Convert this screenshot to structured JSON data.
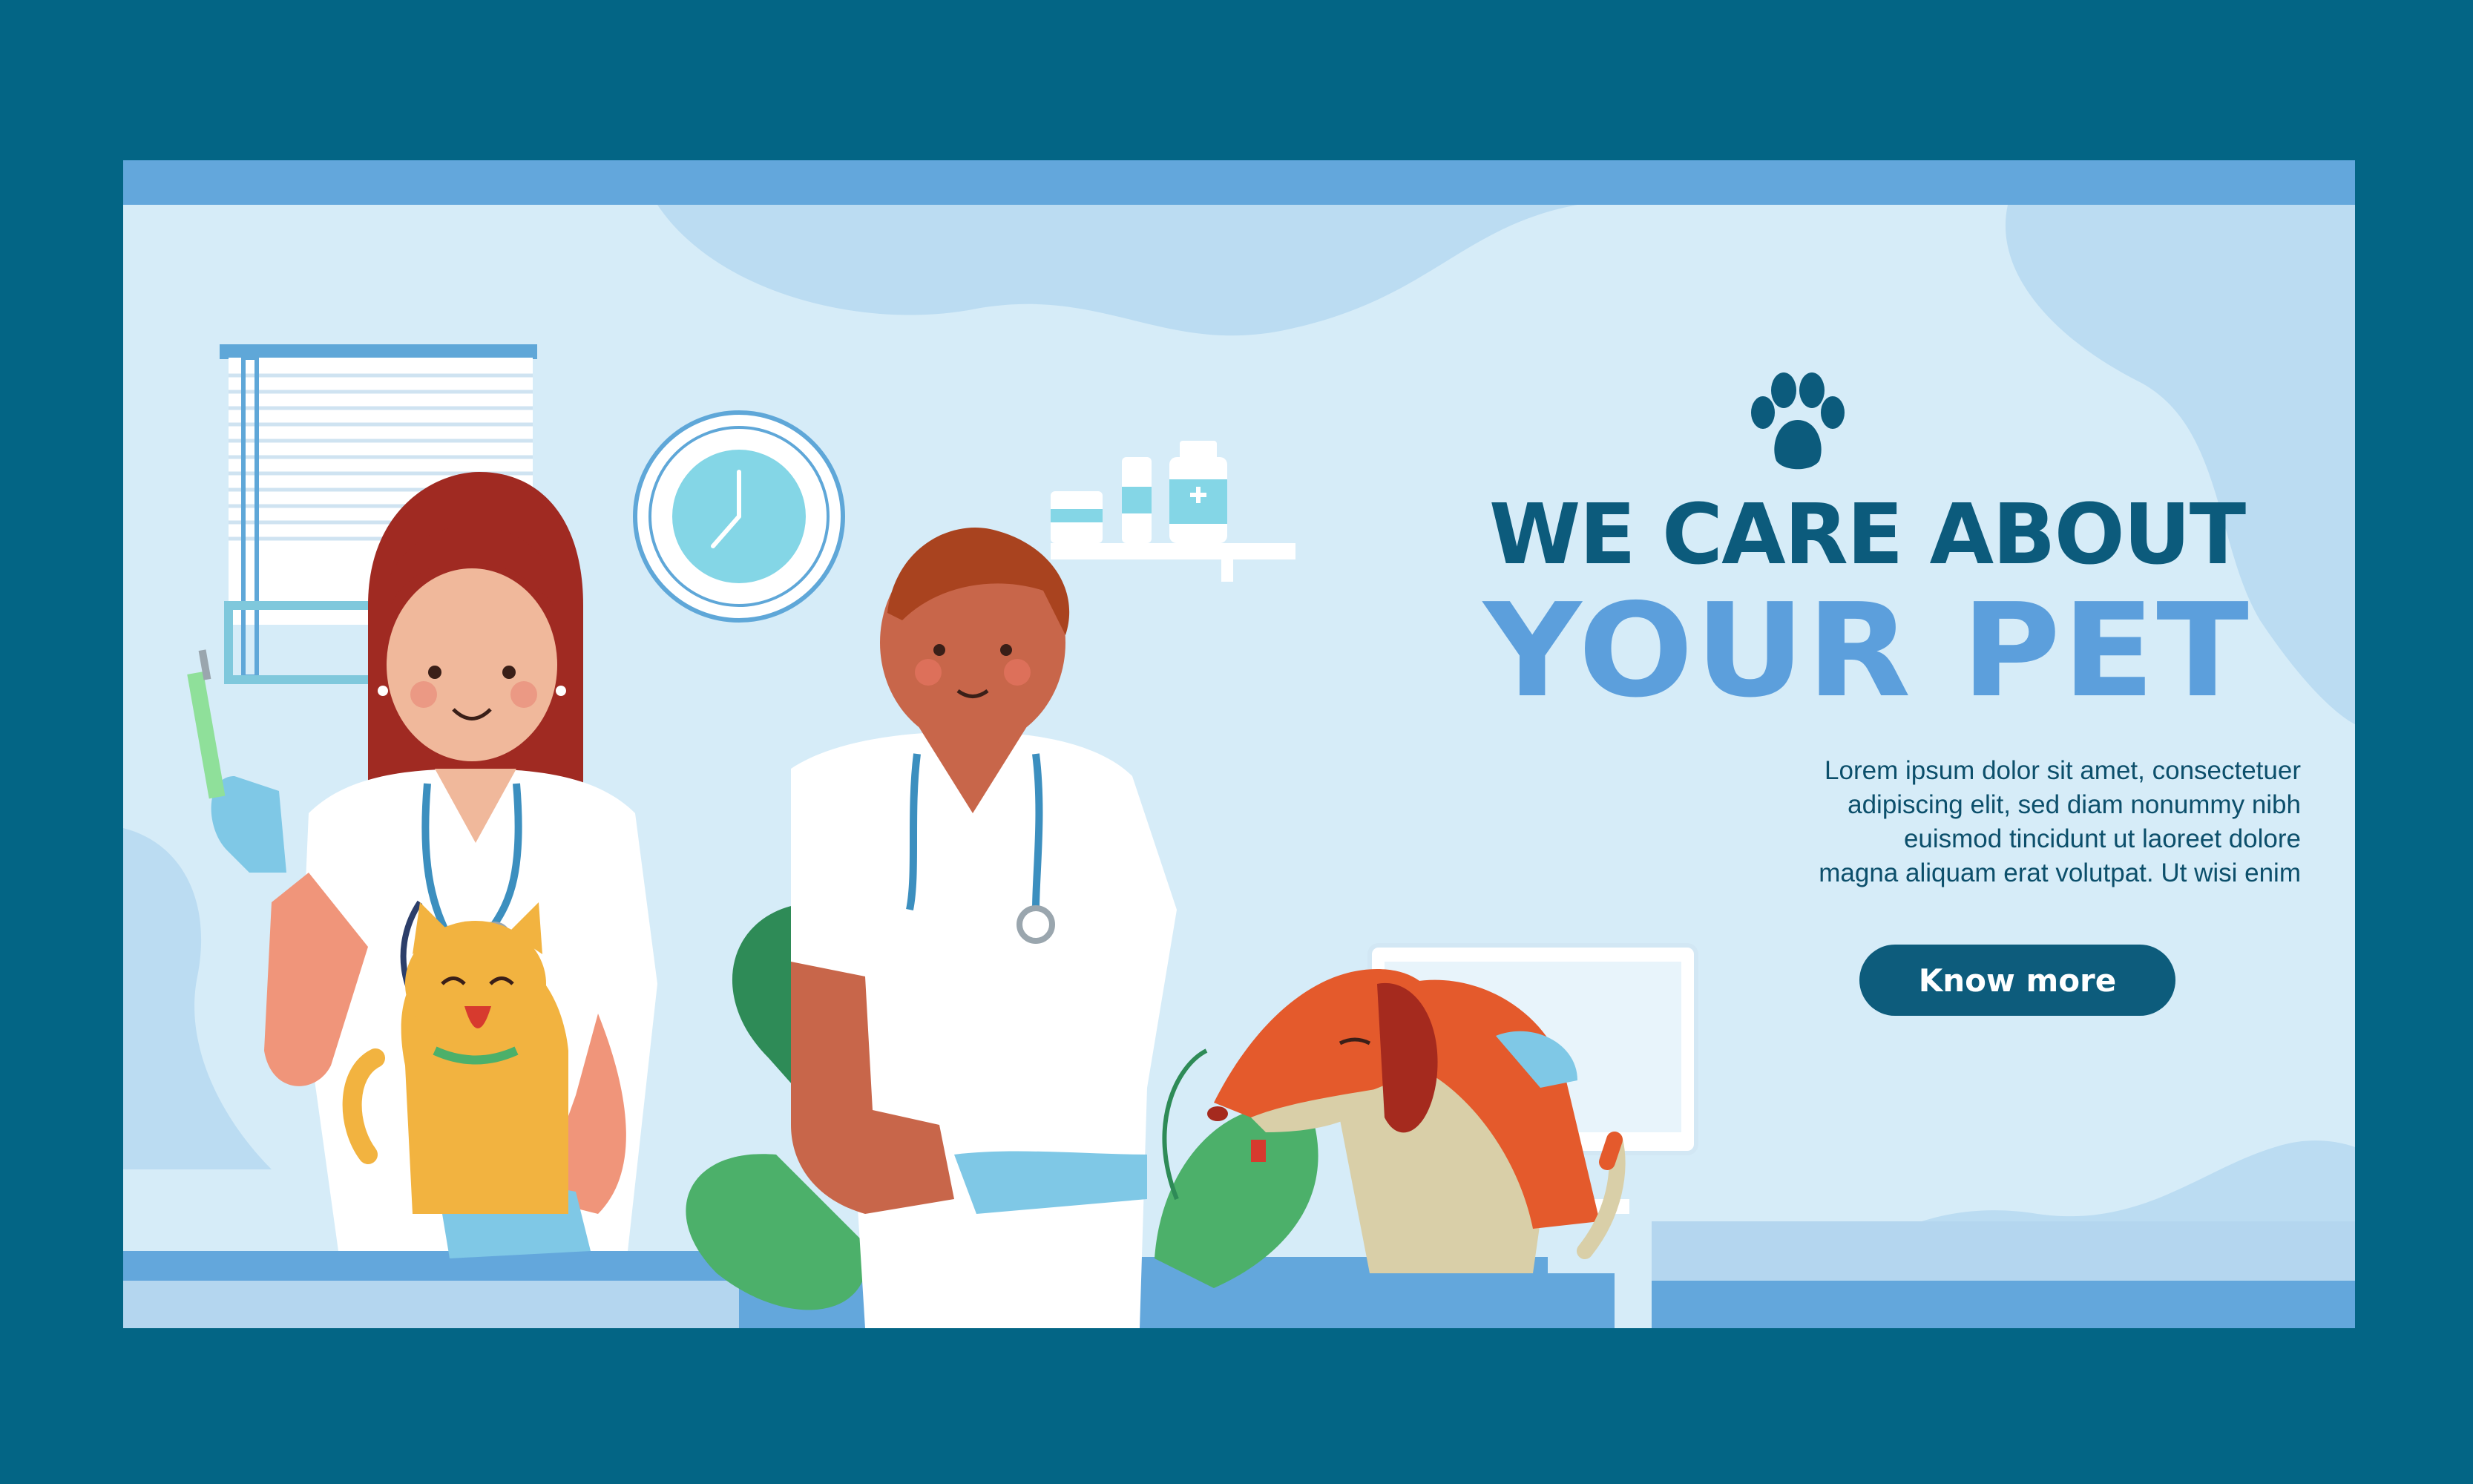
{
  "headline": {
    "line1": "WE CARE ABOUT",
    "line2": "YOUR PET"
  },
  "body_lines": [
    "Lorem ipsum dolor sit amet, consectetuer",
    "adipiscing elit, sed diam nonummy nibh",
    "euismod tincidunt ut laoreet dolore",
    "magna aliquam erat volutpat. Ut wisi enim"
  ],
  "cta": {
    "label": "Know more"
  },
  "icons": {
    "paw": "paw-icon",
    "clock": "clock-icon",
    "syringe": "syringe-icon"
  },
  "colors": {
    "outer_background": "#036585",
    "banner_background": "#d6ecf8",
    "headline_dark": "#0c5b7c",
    "headline_light": "#5c9fdc",
    "button": "#0d5c7c",
    "accent_blue": "#63a7dc"
  }
}
